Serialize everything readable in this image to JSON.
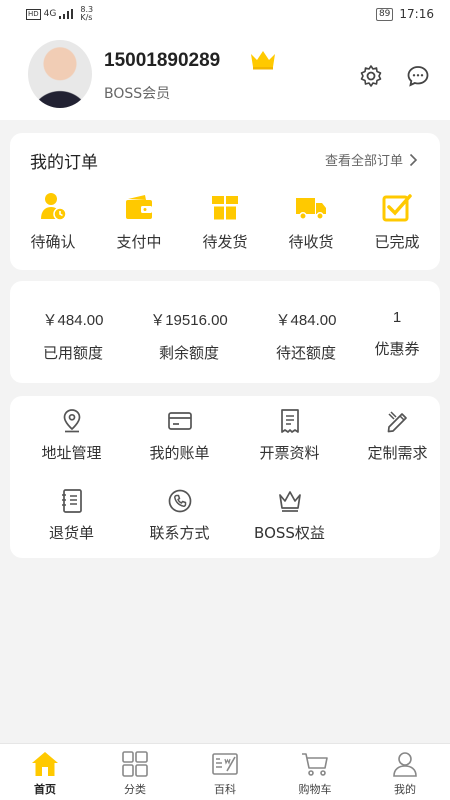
{
  "status_bar": {
    "hd": "HD",
    "network": "4G",
    "speed_value": "8.3",
    "speed_unit": "K/s",
    "battery": "89",
    "time": "17:16"
  },
  "profile": {
    "phone": "15001890289",
    "member_level": "BOSS会员"
  },
  "orders": {
    "title": "我的订单",
    "view_all": "查看全部订单",
    "items": [
      {
        "label": "待确认",
        "icon": "user-clock-icon"
      },
      {
        "label": "支付中",
        "icon": "wallet-icon"
      },
      {
        "label": "待发货",
        "icon": "gift-box-icon"
      },
      {
        "label": "待收货",
        "icon": "truck-icon"
      },
      {
        "label": "已完成",
        "icon": "check-square-icon"
      }
    ]
  },
  "credit": {
    "items": [
      {
        "value": "￥484.00",
        "label": "已用额度"
      },
      {
        "value": "￥19516.00",
        "label": "剩余额度"
      },
      {
        "value": "￥484.00",
        "label": "待还额度"
      },
      {
        "value": "1",
        "label": "优惠券"
      }
    ]
  },
  "tools": {
    "items": [
      {
        "label": "地址管理",
        "icon": "location-pin-icon"
      },
      {
        "label": "我的账单",
        "icon": "card-icon"
      },
      {
        "label": "开票资料",
        "icon": "invoice-icon"
      },
      {
        "label": "定制需求",
        "icon": "pencil-ruler-icon"
      },
      {
        "label": "退货单",
        "icon": "notebook-icon"
      },
      {
        "label": "联系方式",
        "icon": "phone-circle-icon"
      },
      {
        "label": "BOSS权益",
        "icon": "crown-icon"
      }
    ]
  },
  "tabbar": {
    "items": [
      {
        "label": "首页",
        "icon": "home-icon",
        "active": true
      },
      {
        "label": "分类",
        "icon": "category-icon",
        "active": false
      },
      {
        "label": "百科",
        "icon": "encyclopedia-icon",
        "active": false
      },
      {
        "label": "购物车",
        "icon": "cart-icon",
        "active": false
      },
      {
        "label": "我的",
        "icon": "profile-icon",
        "active": false
      }
    ]
  },
  "colors": {
    "accent": "#ffc900",
    "background": "#f3f3f3",
    "card": "#ffffff",
    "text": "#333333"
  }
}
